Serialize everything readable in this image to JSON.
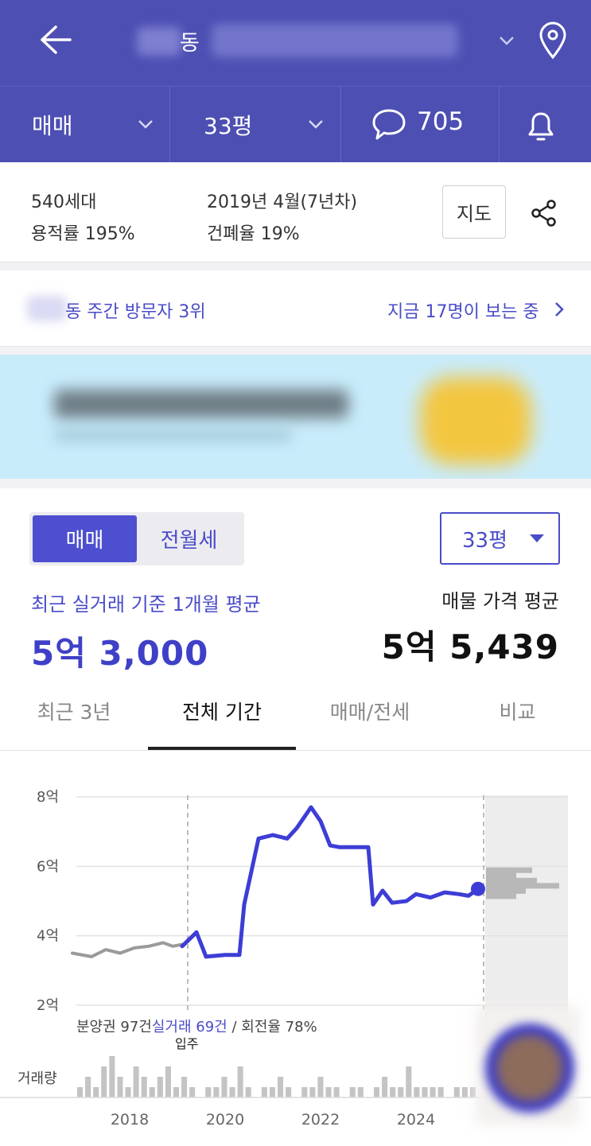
{
  "header": {
    "back_icon": "back-arrow-icon",
    "title_visible": "동",
    "chevron_icon": "chevron-down-icon",
    "location_icon": "location-pin-icon"
  },
  "subbar": {
    "deal_type": "매매",
    "area": "33평",
    "comment_count": "705",
    "bell_icon": "bell-icon"
  },
  "info": {
    "households": "540세대",
    "built": "2019년 4월(7년차)",
    "floor_area_ratio": "용적률 195%",
    "building_coverage": "건폐율 19%",
    "map_button": "지도",
    "share_icon": "share-icon"
  },
  "visitor": {
    "rank_text": "동 주간 방문자 3위",
    "now_viewing": "지금 17명이 보는 중"
  },
  "price": {
    "toggle_sale": "매매",
    "toggle_rent": "전월세",
    "size_select": "33평",
    "recent_label": "최근 실거래 기준 1개월 평균",
    "recent_value": "5억 3,000",
    "listing_label": "매물 가격 평균",
    "listing_value": "5억 5,439"
  },
  "tabs": [
    "최근 3년",
    "전체 기간",
    "매매/전세",
    "비교"
  ],
  "chart_data": {
    "type": "line",
    "y_ticks": [
      "8억",
      "6억",
      "4억",
      "2억"
    ],
    "x_ticks": [
      "2018",
      "2020",
      "2022",
      "2024"
    ],
    "ylim": [
      2,
      8
    ],
    "y_unit": "억",
    "series": [
      {
        "x": [
          2016.8,
          2017.2,
          2017.5,
          2017.8,
          2018.1,
          2018.4,
          2018.7,
          2018.9,
          2019.1
        ],
        "values": [
          3.5,
          3.4,
          3.6,
          3.5,
          3.65,
          3.7,
          3.8,
          3.7,
          3.75
        ],
        "color": "#9a9a9a"
      },
      {
        "x": [
          2019.1,
          2019.4,
          2019.6,
          2020.0,
          2020.3,
          2020.4,
          2020.7,
          2021.0,
          2021.3,
          2021.5,
          2021.8,
          2022.0,
          2022.2,
          2022.4,
          2022.7,
          2023.0,
          2023.1,
          2023.3,
          2023.5,
          2023.8,
          2024.0,
          2024.3,
          2024.6,
          2024.9,
          2025.1,
          2025.3
        ],
        "values": [
          3.7,
          4.1,
          3.4,
          3.45,
          3.45,
          4.9,
          6.8,
          6.9,
          6.8,
          7.1,
          7.7,
          7.3,
          6.6,
          6.55,
          6.55,
          6.55,
          4.9,
          5.3,
          4.95,
          5.0,
          5.2,
          5.1,
          5.25,
          5.2,
          5.15,
          5.35
        ],
        "color": "#3d3dd6"
      }
    ],
    "annotations": {
      "note_prefix": "분양권 97건",
      "note_highlight": "실거래 69건",
      "note_suffix": " / 회전율 78%",
      "move_in": "입주",
      "volume_label": "거래량"
    },
    "volume": [
      1,
      2,
      1,
      3,
      4,
      2,
      1,
      3,
      2,
      1,
      2,
      3,
      1,
      2,
      1,
      0,
      1,
      1,
      2,
      1,
      3,
      1,
      0,
      1,
      1,
      2,
      1,
      0,
      1,
      1,
      2,
      1,
      1,
      0,
      1,
      1,
      0,
      1,
      2,
      1,
      1,
      3,
      1,
      1,
      1,
      1,
      0,
      1,
      1,
      1
    ]
  }
}
